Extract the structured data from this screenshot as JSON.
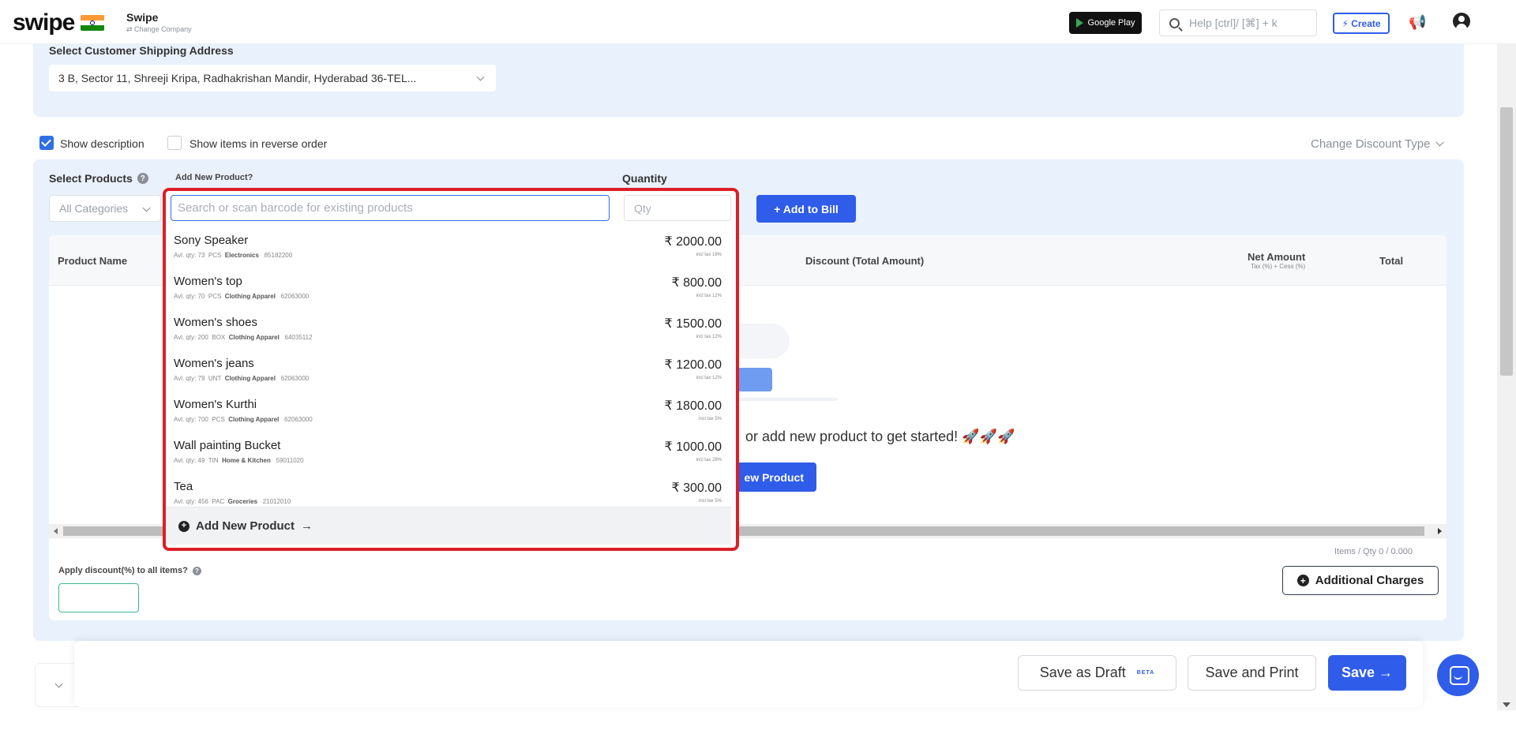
{
  "header": {
    "logo": "swipe",
    "company_name": "Swipe",
    "company_sub": "⇄ Change Company",
    "google_play": "Google Play",
    "help_placeholder": "Help [ctrl]/ [⌘] + k",
    "create_label": "⚡ Create"
  },
  "shipping": {
    "label": "Select Customer Shipping Address",
    "value": "3 B, Sector 11, Shreeji Kripa, Radhakrishan Mandir, Hyderabad 36-TEL..."
  },
  "options": {
    "show_description": "Show description",
    "reverse_order": "Show items in reverse order",
    "change_discount_type": "Change Discount Type"
  },
  "products": {
    "select_label": "Select Products",
    "add_new_question": "Add New Product?",
    "quantity_label": "Quantity",
    "all_categories": "All Categories",
    "search_placeholder": "Search or scan barcode for existing products",
    "qty_placeholder": "Qty",
    "add_to_bill": "+ Add to Bill"
  },
  "table": {
    "col_product_name": "Product Name",
    "col_discount": "Discount (Total Amount)",
    "col_net_amount": "Net Amount",
    "col_net_sub": "Tax (%) + Cess (%)",
    "col_total": "Total",
    "empty_text": "or add new product to get started! 🚀🚀🚀",
    "empty_button": "ew Product",
    "items_qty": "Items / Qty 0 / 0.000",
    "apply_discount": "Apply discount(%) to all items?",
    "additional_charges": "Additional Charges"
  },
  "dropdown": {
    "items": [
      {
        "name": "Sony Speaker",
        "avl": "Avl. qty: 73",
        "unit": "PCS",
        "category": "Electronics",
        "code": "85182200",
        "price": "₹ 2000.00",
        "tax": "incl tax 18%"
      },
      {
        "name": "Women's top",
        "avl": "Avl. qty: 70",
        "unit": "PCS",
        "category": "Clothing Apparel",
        "code": "62063000",
        "price": "₹ 800.00",
        "tax": "incl tax 12%"
      },
      {
        "name": "Women's shoes",
        "avl": "Avl. qty: 200",
        "unit": "BOX",
        "category": "Clothing Apparel",
        "code": "64035112",
        "price": "₹ 1500.00",
        "tax": "incl tax 12%"
      },
      {
        "name": "Women's jeans",
        "avl": "Avl. qty: 79",
        "unit": "UNT",
        "category": "Clothing Apparel",
        "code": "62063000",
        "price": "₹ 1200.00",
        "tax": "incl tax 12%"
      },
      {
        "name": "Women's Kurthi",
        "avl": "Avl. qty: 700",
        "unit": "PCS",
        "category": "Clothing Apparel",
        "code": "62063000",
        "price": "₹ 1800.00",
        "tax": "incl tax 5%"
      },
      {
        "name": "Wall painting Bucket",
        "avl": "Avl. qty: 49",
        "unit": "TIN",
        "category": "Home & Kitchen",
        "code": "59011020",
        "price": "₹ 1000.00",
        "tax": "incl tax 28%"
      },
      {
        "name": "Tea",
        "avl": "Avl. qty: 456",
        "unit": "PAC",
        "category": "Groceries",
        "code": "21012010",
        "price": "₹ 300.00",
        "tax": "incl tax 5%"
      }
    ],
    "add_new_product": "Add New Product"
  },
  "footer": {
    "save_draft": "Save as Draft",
    "beta": "BETA",
    "save_print": "Save and Print",
    "save": "Save →"
  },
  "colors": {
    "accent": "#2f5ce8",
    "highlight": "#dc1f26",
    "panel": "#e9f1fd"
  }
}
